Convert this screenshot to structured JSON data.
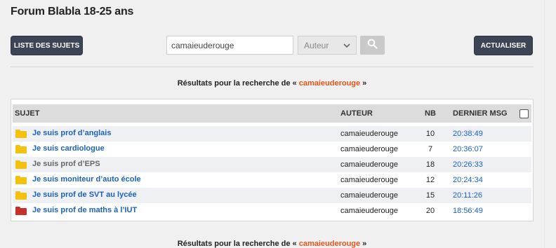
{
  "forum_title": "Forum Blabla 18-25 ans",
  "buttons": {
    "list_topics": "LISTE DES SUJETS",
    "refresh": "ACTUALISER"
  },
  "search": {
    "value": "camaieuderouge",
    "type_selected": "Auteur"
  },
  "results": {
    "prefix": "Résultats pour la recherche de « ",
    "term": "camaieuderouge",
    "suffix": " »"
  },
  "table": {
    "headers": {
      "subject": "SUJET",
      "author": "AUTEUR",
      "nb": "NB",
      "last_msg": "DERNIER MSG"
    },
    "rows": [
      {
        "title": "Je suis prof d’anglais",
        "author": "camaieuderouge",
        "nb": "10",
        "time": "20:38:49",
        "folder_color": "#f4c20d",
        "title_color": "blue"
      },
      {
        "title": "Je suis cardiologue",
        "author": "camaieuderouge",
        "nb": "7",
        "time": "20:36:07",
        "folder_color": "#f4c20d",
        "title_color": "blue"
      },
      {
        "title": "Je suis prof d’EPS",
        "author": "camaieuderouge",
        "nb": "18",
        "time": "20:26:33",
        "folder_color": "#f4c20d",
        "title_color": "grey"
      },
      {
        "title": "Je suis moniteur d’auto école",
        "author": "camaieuderouge",
        "nb": "12",
        "time": "20:24:34",
        "folder_color": "#f4c20d",
        "title_color": "blue"
      },
      {
        "title": "Je suis prof de SVT au lycée",
        "author": "camaieuderouge",
        "nb": "15",
        "time": "20:11:26",
        "folder_color": "#f4c20d",
        "title_color": "blue"
      },
      {
        "title": "Je suis prof de maths à l’IUT",
        "author": "camaieuderouge",
        "nb": "20",
        "time": "18:56:49",
        "folder_color": "#c8302a",
        "title_color": "blue"
      }
    ]
  },
  "colors": {
    "accent": "#e8541c",
    "link": "#1a62c4",
    "button_dark": "#3d4455"
  }
}
